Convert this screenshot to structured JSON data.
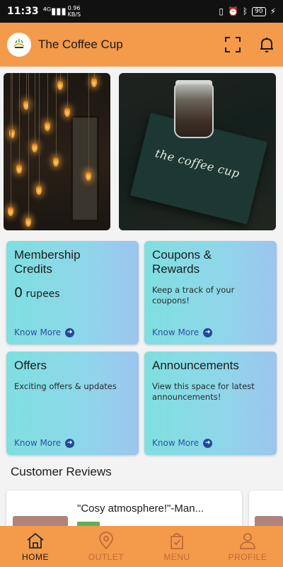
{
  "status_bar": {
    "time": "11:33",
    "network_speed_top": "0.96",
    "network_speed_bottom": "KB/S",
    "battery": "90"
  },
  "header": {
    "title": "The Coffee Cup",
    "logo_icon": "coffee-logo-icon",
    "icons": [
      "scan-icon",
      "bell-icon"
    ]
  },
  "banners": [
    {
      "name": "cafe-lights-banner"
    },
    {
      "name": "coffee-menu-banner",
      "menu_text": "the coffee cup"
    }
  ],
  "cards": {
    "membership": {
      "title_line1": "Membership",
      "title_line2": "Credits",
      "amount": "0",
      "unit": "rupees",
      "link": "Know More"
    },
    "coupons": {
      "title_line1": "Coupons &",
      "title_line2": "Rewards",
      "desc": "Keep a track of your coupons!",
      "link": "Know More"
    },
    "offers": {
      "title": "Offers",
      "desc": "Exciting offers & updates",
      "link": "Know More"
    },
    "announcements": {
      "title": "Announcements",
      "desc": "View this space for latest announcements!",
      "link": "Know More"
    }
  },
  "reviews": {
    "section_title": "Customer Reviews",
    "items": [
      {
        "quote": "\"Cosy atmosphere!\"-Man..."
      }
    ]
  },
  "bottom_nav": {
    "items": [
      {
        "label": "HOME",
        "active": true
      },
      {
        "label": "OUTLET",
        "active": false
      },
      {
        "label": "MENU",
        "active": false
      },
      {
        "label": "PROFILE",
        "active": false
      }
    ]
  },
  "colors": {
    "primary": "#f39a4b",
    "card_gradient_start": "#7fdfe0",
    "card_gradient_end": "#9dc5ee",
    "link": "#2c54a0"
  }
}
